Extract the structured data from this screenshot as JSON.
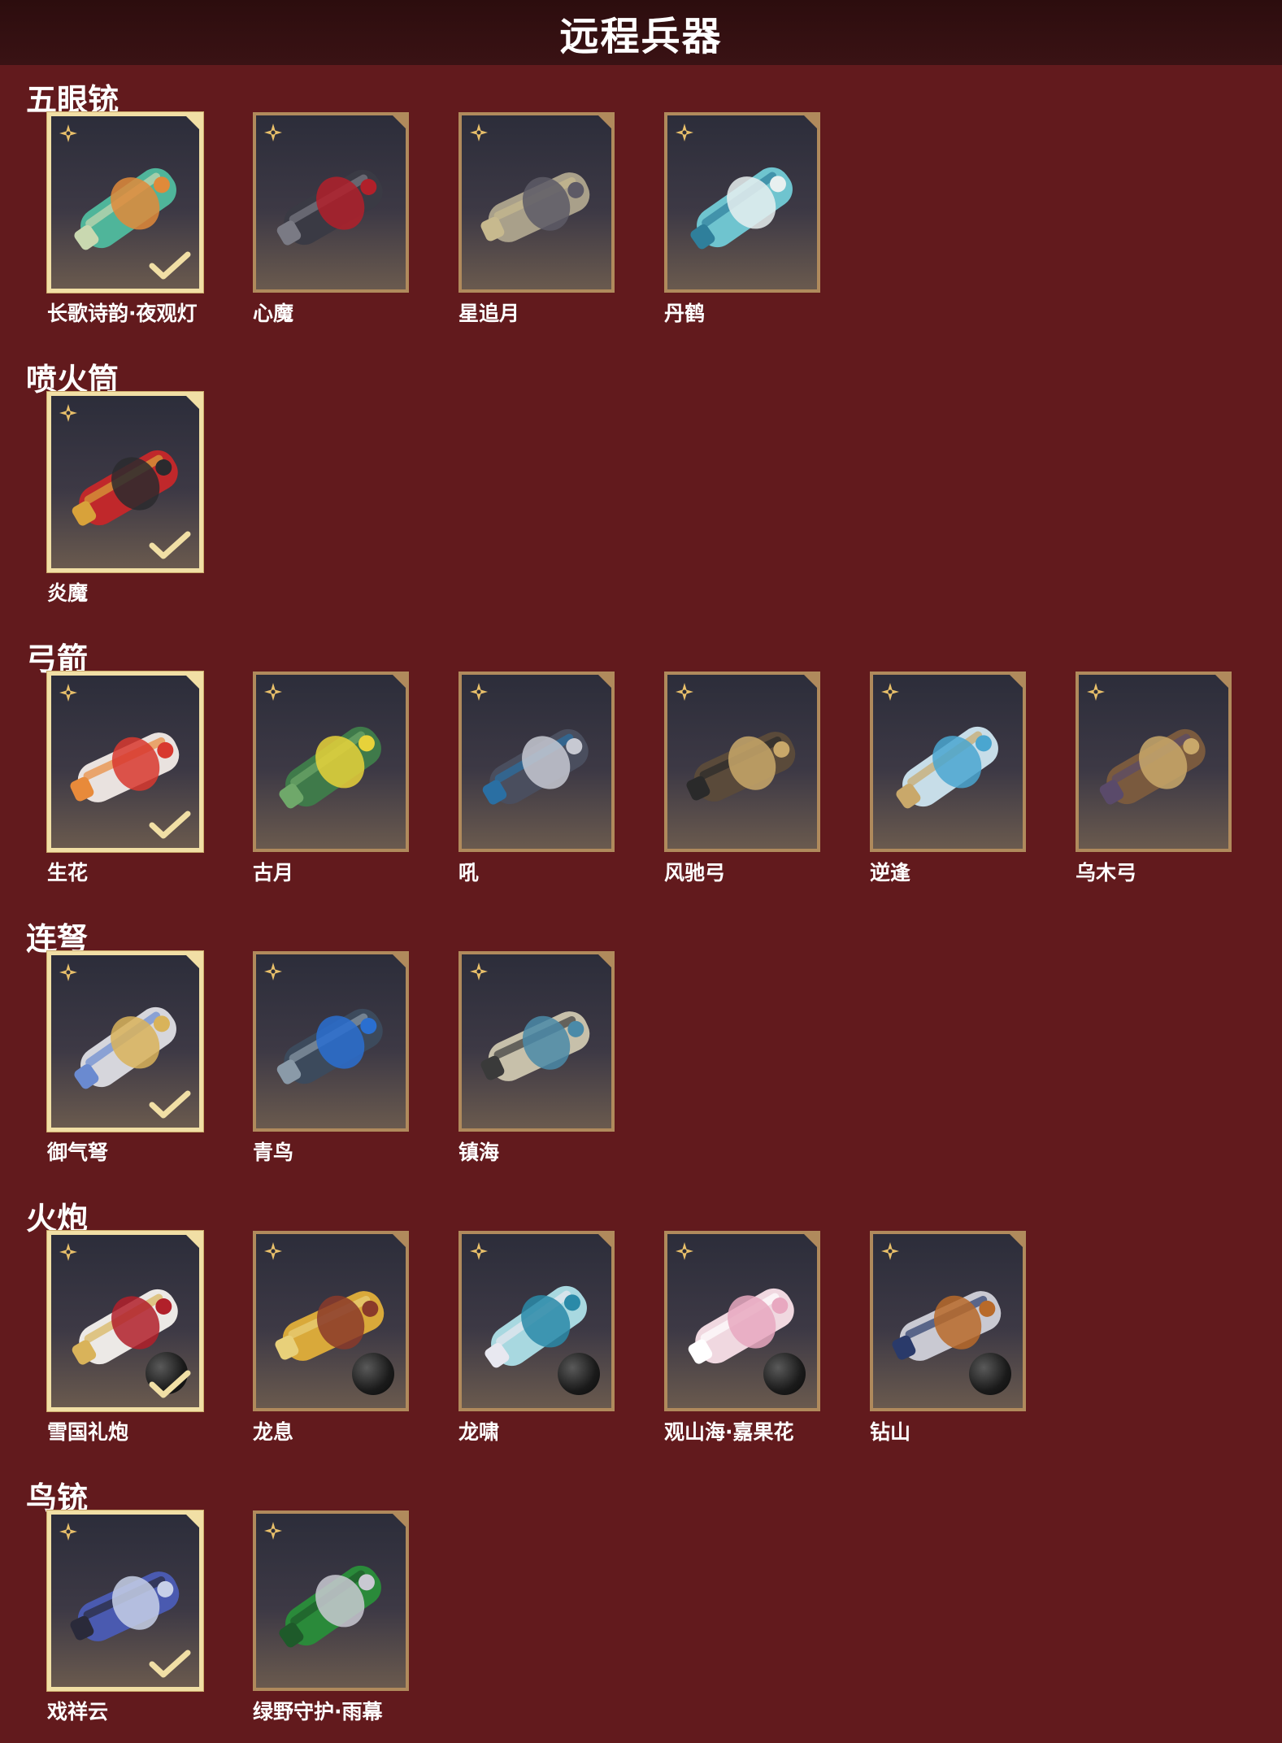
{
  "header": {
    "title": "远程兵器"
  },
  "colors": {
    "background": "#621a1d",
    "header_bg": "#2c0d0e",
    "frame": "#b08a5c",
    "frame_selected": "#f1dfa5"
  },
  "sections": [
    {
      "title": "五眼铳",
      "items": [
        {
          "label": "长歌诗韵·夜观灯",
          "selected": true,
          "ammo": false,
          "palette": [
            "#4fb59a",
            "#e08a3a",
            "#c9d8b0"
          ]
        },
        {
          "label": "心魔",
          "selected": false,
          "ammo": false,
          "palette": [
            "#3a3a44",
            "#b1202a",
            "#7a7a84"
          ]
        },
        {
          "label": "星追月",
          "selected": false,
          "ammo": false,
          "palette": [
            "#a9a08a",
            "#5d5a66",
            "#c7b98e"
          ]
        },
        {
          "label": "丹鹤",
          "selected": false,
          "ammo": false,
          "palette": [
            "#6fc4cf",
            "#e8f0f0",
            "#2f7f9b"
          ]
        }
      ]
    },
    {
      "title": "喷火筒",
      "items": [
        {
          "label": "炎魔",
          "selected": true,
          "ammo": false,
          "palette": [
            "#c0282b",
            "#2a2a2e",
            "#d8a23a"
          ]
        }
      ]
    },
    {
      "title": "弓箭",
      "items": [
        {
          "label": "生花",
          "selected": true,
          "ammo": false,
          "palette": [
            "#e9e2df",
            "#d8382f",
            "#e88a3a"
          ]
        },
        {
          "label": "古月",
          "selected": false,
          "ammo": false,
          "palette": [
            "#3f7a4a",
            "#e7d23a",
            "#6fa86a"
          ]
        },
        {
          "label": "吼",
          "selected": false,
          "ammo": false,
          "palette": [
            "#4a4e5e",
            "#c7c9d2",
            "#2a6fa3"
          ]
        },
        {
          "label": "风驰弓",
          "selected": false,
          "ammo": false,
          "palette": [
            "#5a4a3a",
            "#c9a86a",
            "#2a2a2a"
          ]
        },
        {
          "label": "逆逢",
          "selected": false,
          "ammo": false,
          "palette": [
            "#c7dde8",
            "#4aa6d0",
            "#c9a86a"
          ]
        },
        {
          "label": "乌木弓",
          "selected": false,
          "ammo": false,
          "palette": [
            "#7a5a3e",
            "#c9a86a",
            "#5a4a6a"
          ]
        }
      ]
    },
    {
      "title": "连弩",
      "items": [
        {
          "label": "御气弩",
          "selected": true,
          "ammo": false,
          "palette": [
            "#d6d6dc",
            "#d9b35a",
            "#6a8ad0"
          ]
        },
        {
          "label": "青鸟",
          "selected": false,
          "ammo": false,
          "palette": [
            "#3c4a5c",
            "#2a6fd0",
            "#8a9aa8"
          ]
        },
        {
          "label": "镇海",
          "selected": false,
          "ammo": false,
          "palette": [
            "#c7c0aa",
            "#4a8aa8",
            "#3a3a3a"
          ]
        }
      ]
    },
    {
      "title": "火炮",
      "items": [
        {
          "label": "雪国礼炮",
          "selected": true,
          "ammo": true,
          "palette": [
            "#ece9e6",
            "#b1202a",
            "#d9b35a"
          ]
        },
        {
          "label": "龙息",
          "selected": false,
          "ammo": true,
          "palette": [
            "#d9a93a",
            "#8a3a2a",
            "#e8d07a"
          ]
        },
        {
          "label": "龙啸",
          "selected": false,
          "ammo": true,
          "palette": [
            "#a8d8e0",
            "#2a8aa8",
            "#e8e8f0"
          ]
        },
        {
          "label": "观山海·嘉果花",
          "selected": false,
          "ammo": true,
          "palette": [
            "#f0d8e0",
            "#e8a8c0",
            "#ffffff"
          ]
        },
        {
          "label": "钻山",
          "selected": false,
          "ammo": true,
          "palette": [
            "#c9c9d2",
            "#b86a2a",
            "#2a3a6a"
          ]
        }
      ]
    },
    {
      "title": "鸟铳",
      "items": [
        {
          "label": "戏祥云",
          "selected": true,
          "ammo": false,
          "palette": [
            "#4a5ab0",
            "#c7d0e8",
            "#2a2a3a"
          ]
        },
        {
          "label": "绿野守护·雨幕",
          "selected": false,
          "ammo": false,
          "palette": [
            "#2a8a3a",
            "#c9c9d2",
            "#1e5a2a"
          ]
        }
      ]
    }
  ]
}
